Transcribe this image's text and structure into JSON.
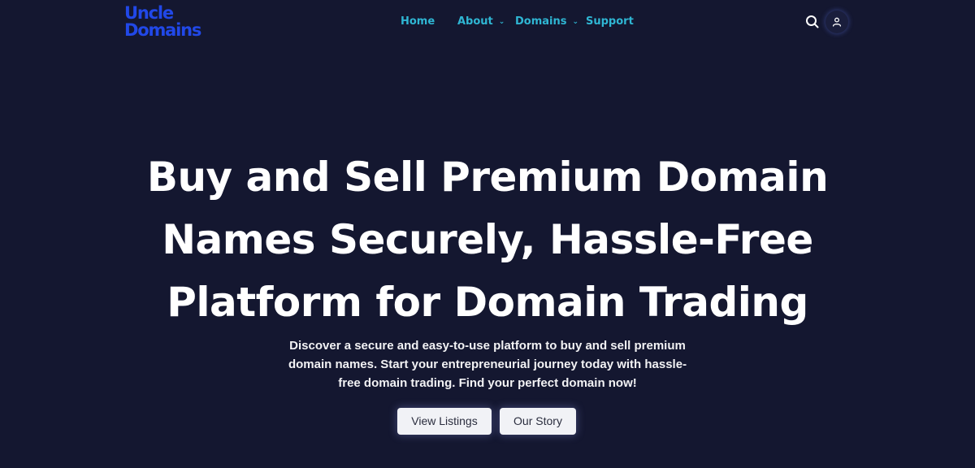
{
  "brand": {
    "line1": "Uncle",
    "line2": "Domains",
    "color": "#2148e8"
  },
  "nav": {
    "home": "Home",
    "about": "About",
    "domains": "Domains",
    "support": "Support",
    "link_color": "#2fb6d3"
  },
  "header_icons": {
    "search": "search-icon",
    "user": "user-icon"
  },
  "hero": {
    "title_lines": [
      "Buy and Sell Premium Domain",
      "Names Securely, Hassle-Free",
      "Platform for Domain Trading"
    ],
    "subtitle_lines": [
      "Discover a secure and easy-to-use platform to buy and sell premium",
      "domain names. Start your entrepreneurial journey today with hassle-",
      "free domain trading. Find your perfect domain now!"
    ],
    "primary_button": "View Listings",
    "secondary_button": "Our Story"
  },
  "colors": {
    "background": "#141730",
    "button_bg": "#f1f2f6"
  }
}
